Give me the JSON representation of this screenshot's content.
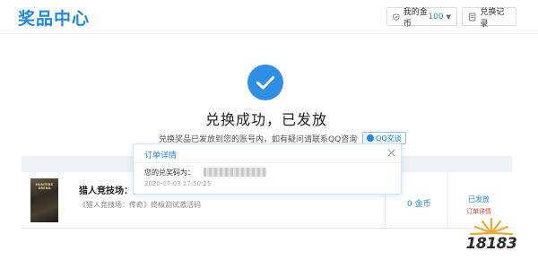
{
  "header": {
    "title": "奖品中心",
    "coins_label": "我的金币",
    "coins_value": "100",
    "records_label": "兑换记录"
  },
  "success": {
    "title": "兑换成功，已发放",
    "message": "兑换奖品已发放到您的账号内，如有疑问请联系QQ咨询",
    "qq_button": "QQ交谈"
  },
  "order": {
    "cover_text": "HUNTERS ARENA",
    "game_name": "猎人竞技场：传奇",
    "description": "《猎人竞技场：传奇》终极测试激活码",
    "price": "0 金币",
    "status": "已发放",
    "details_link": "订单详情"
  },
  "popup": {
    "title": "订单详情",
    "code_label": "您的兑奖码为：",
    "time": "2020-07-03 17:50:25"
  },
  "watermark": {
    "text": "18183"
  },
  "colors": {
    "accent": "#1e88e5",
    "status_red": "#e53935"
  }
}
